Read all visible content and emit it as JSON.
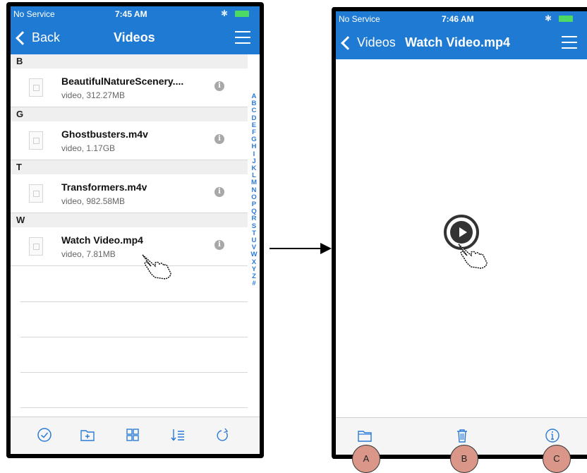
{
  "left_screen": {
    "status": {
      "service": "No Service",
      "time": "7:45 AM"
    },
    "nav": {
      "back_label": "Back",
      "title": "Videos"
    },
    "sections": [
      {
        "letter": "B",
        "file": {
          "name": "BeautifulNatureScenery....",
          "meta": "video, 312.27MB"
        }
      },
      {
        "letter": "G",
        "file": {
          "name": "Ghostbusters.m4v",
          "meta": "video, 1.17GB"
        }
      },
      {
        "letter": "T",
        "file": {
          "name": "Transformers.m4v",
          "meta": "video, 982.58MB"
        }
      },
      {
        "letter": "W",
        "file": {
          "name": "Watch Video.mp4",
          "meta": "video, 7.81MB"
        }
      }
    ],
    "index": [
      "A",
      "B",
      "C",
      "D",
      "E",
      "F",
      "G",
      "H",
      "I",
      "J",
      "K",
      "L",
      "M",
      "N",
      "O",
      "P",
      "Q",
      "R",
      "S",
      "T",
      "U",
      "V",
      "W",
      "X",
      "Y",
      "Z",
      "#"
    ],
    "toolbar": [
      "select-all-icon",
      "new-folder-icon",
      "grid-view-icon",
      "sort-icon",
      "refresh-icon"
    ]
  },
  "right_screen": {
    "status": {
      "service": "No Service",
      "time": "7:46 AM"
    },
    "nav": {
      "back_label": "Videos",
      "title": "Watch Video.mp4"
    },
    "toolbar": [
      "folder-icon",
      "trash-icon",
      "info-icon"
    ]
  },
  "badges": {
    "a": "A",
    "b": "B",
    "c": "C"
  },
  "colors": {
    "nav_blue": "#1e7ad3",
    "accent_blue": "#2b7bd6",
    "badge_fill": "#d99689"
  }
}
